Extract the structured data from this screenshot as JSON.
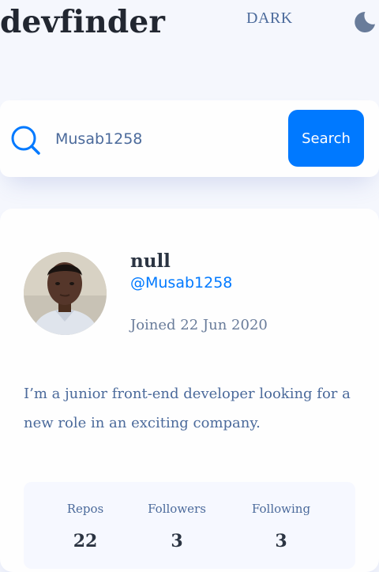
{
  "header": {
    "logo": "devfinder",
    "theme_label": "DARK",
    "theme_icon": "moon-icon"
  },
  "search": {
    "icon": "search-icon",
    "value": "Musab1258",
    "button_label": "Search"
  },
  "profile": {
    "name": "null",
    "login": "@Musab1258",
    "joined": "Joined 22 Jun 2020",
    "bio": "I’m a junior front-end developer looking for a new role in an exciting company.",
    "stats": {
      "repos_label": "Repos",
      "repos_value": "22",
      "followers_label": "Followers",
      "followers_value": "3",
      "following_label": "Following",
      "following_value": "3"
    }
  },
  "colors": {
    "background": "#f5f7fd",
    "accent": "#0079ff",
    "text_dark": "#222731",
    "text_muted": "#4b6a9b"
  }
}
